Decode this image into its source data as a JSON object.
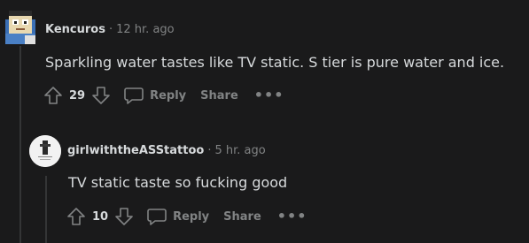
{
  "comments": [
    {
      "username": "Kencuros",
      "separator": "·",
      "time": "12 hr. ago",
      "body": "Sparkling water tastes like TV static. S tier is pure water and ice.",
      "score": "29",
      "reply_label": "Reply",
      "share_label": "Share",
      "more_label": "•••"
    },
    {
      "username": "girlwiththeASStattoo",
      "separator": "·",
      "time": "5 hr. ago",
      "body": "TV static taste so fucking good",
      "score": "10",
      "reply_label": "Reply",
      "share_label": "Share",
      "more_label": "•••"
    }
  ],
  "colors": {
    "background": "#1a1a1b",
    "text": "#d7dadc",
    "muted": "#818384",
    "thread_line": "#343536"
  },
  "icons": [
    "upvote-icon",
    "downvote-icon",
    "comment-bubble-icon",
    "more-options-icon"
  ]
}
